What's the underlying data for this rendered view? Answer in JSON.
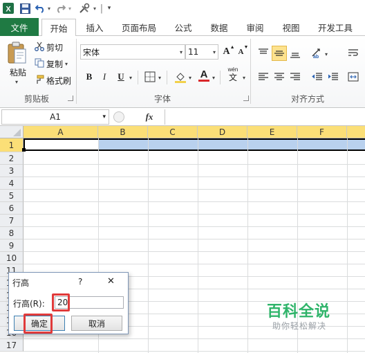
{
  "qat": {
    "separator_char": "|",
    "icons": [
      "excel-logo-icon",
      "save-icon",
      "undo-icon",
      "redo-icon",
      "custom-tools-icon",
      "customize-qat-icon"
    ]
  },
  "tabs": [
    {
      "label": "文件",
      "type": "file"
    },
    {
      "label": "开始",
      "type": "active"
    },
    {
      "label": "插入"
    },
    {
      "label": "页面布局"
    },
    {
      "label": "公式"
    },
    {
      "label": "数据"
    },
    {
      "label": "审阅"
    },
    {
      "label": "视图"
    },
    {
      "label": "开发工具"
    }
  ],
  "clipboard": {
    "paste": "粘贴",
    "cut": "剪切",
    "copy": "复制",
    "format_painter": "格式刷",
    "group_label": "剪贴板"
  },
  "font": {
    "name": "宋体",
    "size": "11",
    "grow": "A",
    "shrink": "A",
    "bold": "B",
    "italic": "I",
    "underline": "U",
    "font_color_letter": "A",
    "wen_char": "wén",
    "wen_big": "文",
    "group_label": "字体",
    "font_color": "#d9262a",
    "fill_color": "#f2d14b"
  },
  "alignment": {
    "group_label": "对齐方式"
  },
  "formula_bar": {
    "name_box": "A1",
    "fx": "fx"
  },
  "grid": {
    "columns": [
      "A",
      "B",
      "C",
      "D",
      "E",
      "F"
    ],
    "rows": [
      "1",
      "2",
      "3",
      "4",
      "5",
      "6",
      "7",
      "8",
      "9",
      "10",
      "11",
      "12",
      "13",
      "14",
      "15",
      "16",
      "17"
    ],
    "header_highlight": "#fbdf77",
    "selected_row_fill": "#b9d1ee"
  },
  "dialog": {
    "title": "行高",
    "help": "?",
    "close": "✕",
    "field_label": "行高(R):",
    "field_value": "20",
    "ok": "确定",
    "cancel": "取消"
  },
  "watermark": {
    "title": "百科全说",
    "subtitle": "助你轻松解决"
  }
}
